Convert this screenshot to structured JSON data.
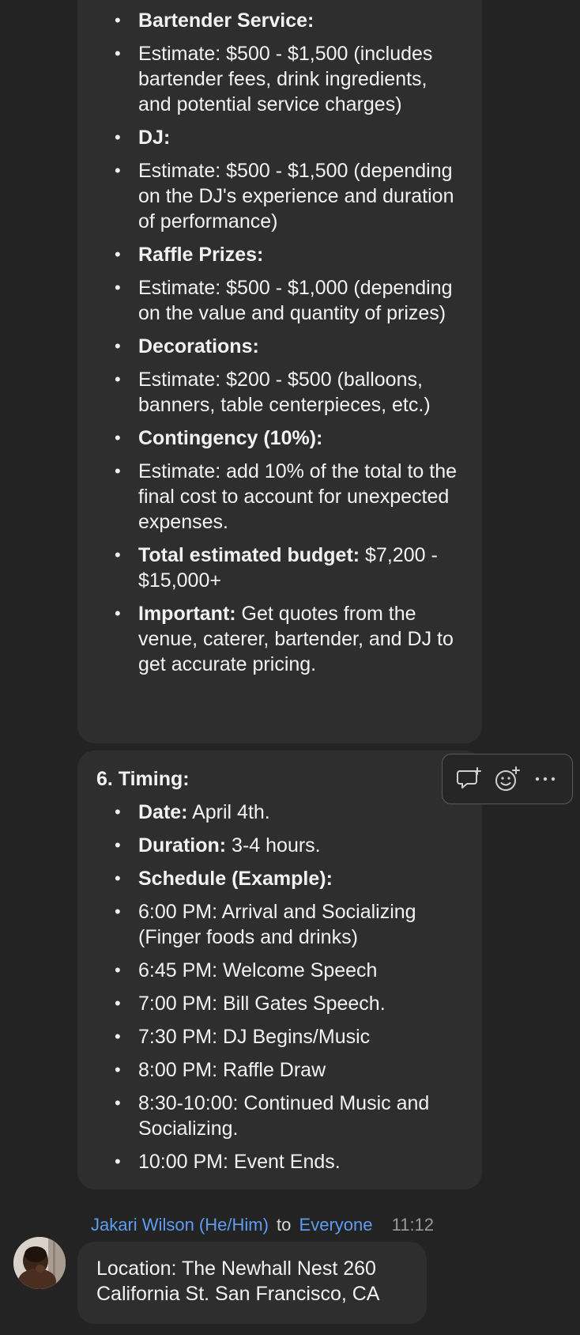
{
  "top_message": {
    "items": [
      {
        "bold": "Bartender Service:",
        "text": ""
      },
      {
        "bold": "",
        "text": "Estimate: $500 - $1,500 (includes bartender fees, drink ingredients, and potential service charges)"
      },
      {
        "bold": "DJ:",
        "text": ""
      },
      {
        "bold": "",
        "text": "Estimate: $500 - $1,500 (depending on the DJ's experience and duration of performance)"
      },
      {
        "bold": "Raffle Prizes:",
        "text": ""
      },
      {
        "bold": "",
        "text": "Estimate: $500 - $1,000 (depending on the value and quantity of prizes)"
      },
      {
        "bold": "Decorations:",
        "text": ""
      },
      {
        "bold": "",
        "text": "Estimate: $200 - $500 (balloons, banners, table centerpieces, etc.)"
      },
      {
        "bold": "Contingency (10%):",
        "text": ""
      },
      {
        "bold": "",
        "text": "Estimate: add 10% of the total to the final cost to account for unexpected expenses."
      },
      {
        "bold": "Total estimated budget:",
        "text": " $7,200 - $15,000+"
      },
      {
        "bold": "Important:",
        "text": " Get quotes from the venue, caterer, bartender, and DJ to get accurate pricing."
      }
    ]
  },
  "timing_message": {
    "heading": "6. Timing:",
    "items": [
      {
        "bold": "Date:",
        "text": " April 4th."
      },
      {
        "bold": "Duration:",
        "text": " 3-4 hours."
      },
      {
        "bold": "Schedule (Example):",
        "text": ""
      },
      {
        "bold": "",
        "text": "6:00 PM: Arrival and Socializing (Finger foods and drinks)"
      },
      {
        "bold": "",
        "text": "6:45 PM: Welcome Speech"
      },
      {
        "bold": "",
        "text": "7:00 PM: Bill Gates Speech."
      },
      {
        "bold": "",
        "text": "7:30 PM: DJ Begins/Music"
      },
      {
        "bold": "",
        "text": "8:00 PM: Raffle Draw"
      },
      {
        "bold": "",
        "text": "8:30-10:00: Continued Music and Socializing."
      },
      {
        "bold": "",
        "text": "10:00 PM: Event Ends."
      }
    ]
  },
  "toolbar": {
    "icons": [
      "reply-thread-icon",
      "add-reaction-icon",
      "more-options-icon"
    ]
  },
  "next_message": {
    "sender": "Jakari Wilson (He/Him)",
    "to": "to",
    "recipient": "Everyone",
    "time": "11:12",
    "text": "Location: The Newhall Nest 260 California St. San Francisco, CA"
  },
  "colors": {
    "background": "#232323",
    "bubble": "#2e2e2f",
    "link": "#5e9cf0",
    "timestamp": "#9a9a9a"
  }
}
